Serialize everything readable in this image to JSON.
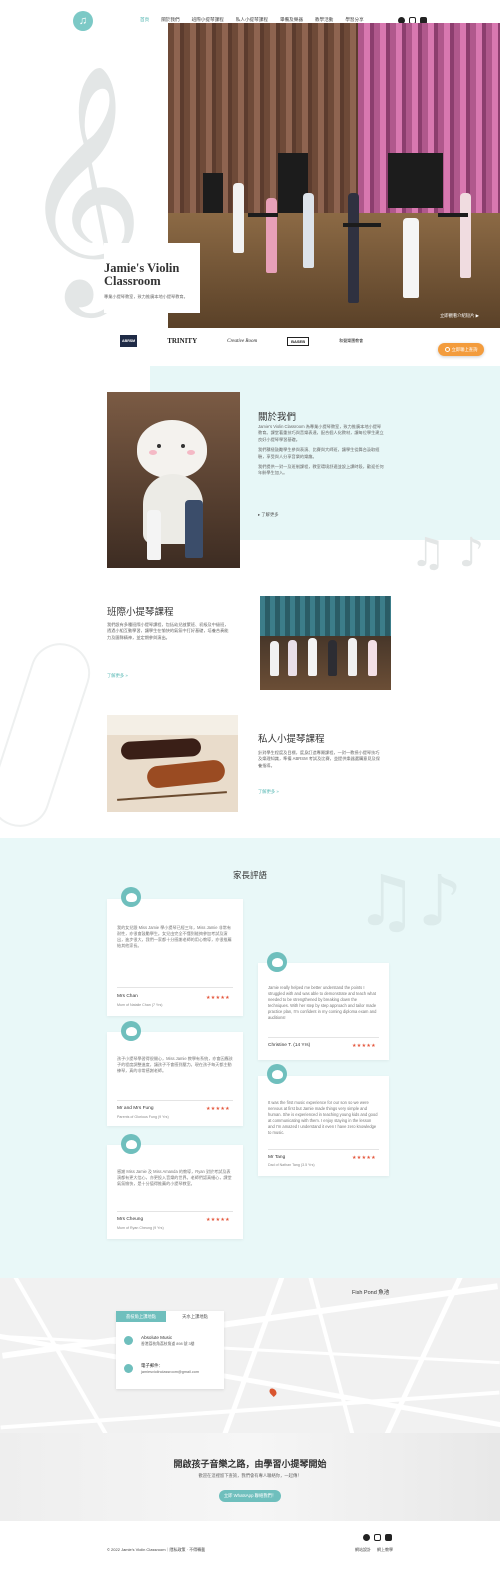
{
  "header": {
    "nav": [
      {
        "label": "首頁",
        "active": true
      },
      {
        "label": "關於我們"
      },
      {
        "label": "班際小提琴課程"
      },
      {
        "label": "私人小提琴課程"
      },
      {
        "label": "畢備及樂器"
      },
      {
        "label": "教學活動"
      },
      {
        "label": "學習分享"
      }
    ],
    "social_icons": [
      "facebook-icon",
      "instagram-icon",
      "youtube-icon"
    ]
  },
  "hero": {
    "title": "Jamie's Violin Classroom",
    "subtitle": "專業小提琴教室，致力推廣本地小提琴教育。",
    "video_caption": "立即觀看介紹短片 ▶",
    "whatsapp_button": "立即聯上查詢"
  },
  "partner_logos": [
    "ABRSM",
    "TRINITY",
    "Creative Room",
    "BASEB",
    "和聲樂團教會"
  ],
  "about": {
    "title": "關於我們",
    "body1": "Jamie's Violin Classroom 為專業小提琴教室，致力推廣本地小提琴教育。課堂著重技巧與音樂表達，配合個人化教材，讓每位學生建立良好小提琴學習基礎。",
    "body2": "我們積極鼓勵學生參與表演、比賽與大師班，讓學生從舞台汲取經驗，享受與人分享音樂的樂趣。",
    "body3": "我們提供一對一及班制課程，教室環境舒適並設上課時段，歡迎任何年齡學生加入。",
    "more": "了解更多"
  },
  "group_class": {
    "title": "班際小提琴課程",
    "body": "我們設有多種班際小提琴課程，包括幼兒啟蒙班、初級及中級班，透過小組互動學習，讓學生在愉快的氣氛中打好基礎，培養合奏能力及團隊精神，並定期參與演出。",
    "more": "了解更多 »"
  },
  "private_class": {
    "title": "私人小提琴課程",
    "body": "針對學生程度及目標，度身訂造專屬課程，一對一教授小提琴技巧及樂理知識，準備 ABRSM 考試及比賽，並提供樂器選購意見及保養指導。",
    "more": "了解更多 »"
  },
  "testimonials": {
    "title": "家長評語",
    "items": [
      {
        "text": "我的女兒跟 Miss Jamie 學小提琴已經三年，Miss Jamie 非常有耐性，亦很會鼓勵學生。女兒由完全不懂到能夠參加考試及演出，進步很大，我們一家都十分感謝老師的用心教導，亦很推薦給其他家長。",
        "name": "Mrs Chan",
        "role": "Mum of Natalie Chan (7 Yrs)",
        "stars": "★★★★★"
      },
      {
        "text": "Jamie really helped me better understand the points I struggled with and was able to demonstrate and teach what needed to be strengthened by breaking down the techniques. With her step by step approach and tailor made practice plan, I'm confident in my coming diploma exam and auditions!",
        "name": "Christine T. (14 Yrs)",
        "role": "",
        "stars": "★★★★★"
      },
      {
        "text": "孩子小提琴學習得很開心，Miss Jamie 教學有系統，亦會因應孩子的程度調整進度，讓孩子不會感到壓力。現在孩子每天都主動練琴，真的非常感謝老師。",
        "name": "Mr and Mrs Fung",
        "role": "Parents of Glorious Fung (9 Yrs)",
        "stars": "★★★★★"
      },
      {
        "text": "It was the first music experience for our son so we were nervous at first but Jamie made things very simple and human. She is experienced in teaching young kids and good at communicating with them. I enjoy staying in the lesson and I'm amazed I understand it even I have zero knowledge to music.",
        "name": "Mr Tang",
        "role": "Dad of Nathan Tang (3.5 Yrs)",
        "stars": "★★★★★"
      },
      {
        "text": "感謝 Miss Jamie 及 Miss Amanda 的教導，Ryan 對於考試及表演都有更大信心，亦更投入音樂的世界。老師們認真細心，課堂氣氛愉快，是十分值得推薦的小提琴教室。",
        "name": "Mrs Cheung",
        "role": "Mum of Ryan Cheung (9 Yrs)",
        "stars": "★★★★★"
      }
    ]
  },
  "map": {
    "label": "Fish Pond 魚池",
    "tab_active": "荔枝角上課地點",
    "tab_inactive": "天水上課地點",
    "address_title": "Absolute Music",
    "address_lines": "香港荔枝角荔枝角道 898 號 3樓",
    "email_label": "電子郵件：",
    "email": "jamiesviolinclassroom@gmail.com"
  },
  "cta": {
    "title": "開啟孩子音樂之路，由學習小提琴開始",
    "subtitle": "歡迎在這裡留下查詢，我們會有專人聯絡你，一起傳！",
    "button": "立即 WhatsApp 聯絡我們！"
  },
  "footer": {
    "copyright": "© 2022 Jamie's Violin Classroom｜隱私政策 · 不得轉載",
    "links": [
      "網站設計",
      "網上教學"
    ]
  }
}
